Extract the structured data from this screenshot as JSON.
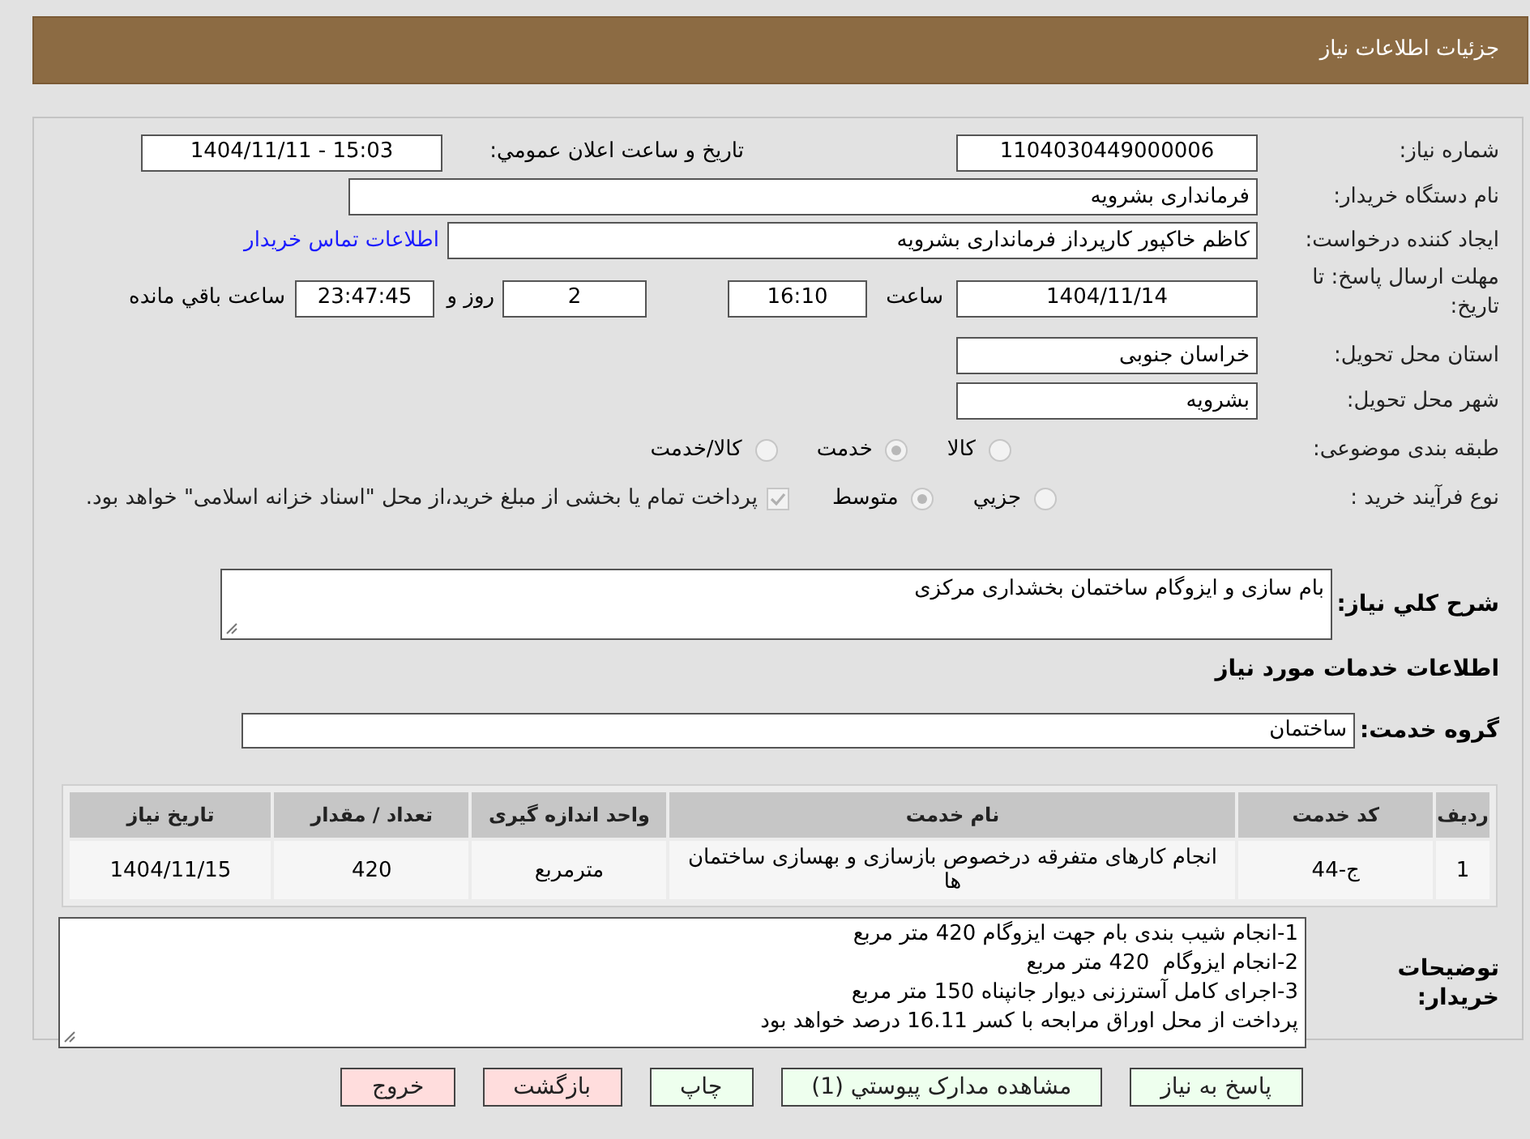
{
  "header": {
    "title": "جزئیات اطلاعات نیاز"
  },
  "need_number": {
    "label": "شماره نیاز:",
    "value": "1104030449000006"
  },
  "announce": {
    "label": "تاریخ و ساعت اعلان عمومي:",
    "value": "1404/11/11 - 15:03"
  },
  "buyer_org": {
    "label": "نام دستگاه خریدار:",
    "value": "فرمانداری بشرویه"
  },
  "requester": {
    "label": "ایجاد کننده درخواست:",
    "value": "کاظم خاکپور کارپرداز فرمانداری بشرویه",
    "link": "اطلاعات تماس خریدار"
  },
  "deadline": {
    "label": "مهلت ارسال پاسخ: تا تاریخ:",
    "date": "1404/11/14",
    "time_label": "ساعت",
    "time": "16:10",
    "days": "2",
    "days_label": "روز و",
    "remaining": "23:47:45",
    "remaining_label": "ساعت باقي مانده"
  },
  "province": {
    "label": "استان محل تحویل:",
    "value": "خراسان جنوبی"
  },
  "city": {
    "label": "شهر محل تحویل:",
    "value": "بشرویه"
  },
  "subject_class": {
    "label": "طبقه بندی موضوعی:",
    "options": [
      {
        "label": "کالا",
        "selected": false
      },
      {
        "label": "خدمت",
        "selected": true
      },
      {
        "label": "کالا/خدمت",
        "selected": false
      }
    ]
  },
  "purchase_process": {
    "label": "نوع فرآیند خرید :",
    "options": [
      {
        "label": "جزيي",
        "selected": false
      },
      {
        "label": "متوسط",
        "selected": true
      }
    ],
    "payment": {
      "checked": true,
      "text": "پرداخت تمام یا بخشی از مبلغ خرید،از محل \"اسناد خزانه اسلامی\" خواهد بود."
    }
  },
  "summary": {
    "label": "شرح كلي نیاز:",
    "value": "بام سازی و ایزوگام ساختمان بخشداری مرکزی"
  },
  "services_heading": "اطلاعات خدمات مورد نیاز",
  "service_group": {
    "label": "گروه خدمت:",
    "value": "ساختمان"
  },
  "table": {
    "columns": [
      "ردیف",
      "کد خدمت",
      "نام خدمت",
      "واحد اندازه گیری",
      "تعداد / مقدار",
      "تاریخ نیاز"
    ],
    "rows": [
      [
        "1",
        "ج-44",
        "انجام کارهای متفرقه درخصوص بازسازی و بهسازی ساختمان ها",
        "مترمربع",
        "420",
        "1404/11/15"
      ]
    ]
  },
  "buyer_notes": {
    "label": "توضیحات خریدار:",
    "lines": [
      "1-انجام شیب بندی بام جهت ایزوگام 420 متر مربع",
      "2-انجام ایزوگام  420 متر مربع",
      "3-اجرای کامل آسترزنی دیوار جانپناه 150 متر مربع",
      "پرداخت از محل اوراق مرابحه با کسر 16.11 درصد خواهد بود"
    ]
  },
  "buttons": [
    {
      "label": "پاسخ به نیاز",
      "color": "#eeffee"
    },
    {
      "label": "مشاهده مدارک پیوستي (1)",
      "color": "#eeffee"
    },
    {
      "label": "چاپ",
      "color": "#eeffee"
    },
    {
      "label": "بازگشت",
      "color": "#ffdddd"
    },
    {
      "label": "خروج",
      "color": "#ffdddd"
    }
  ]
}
